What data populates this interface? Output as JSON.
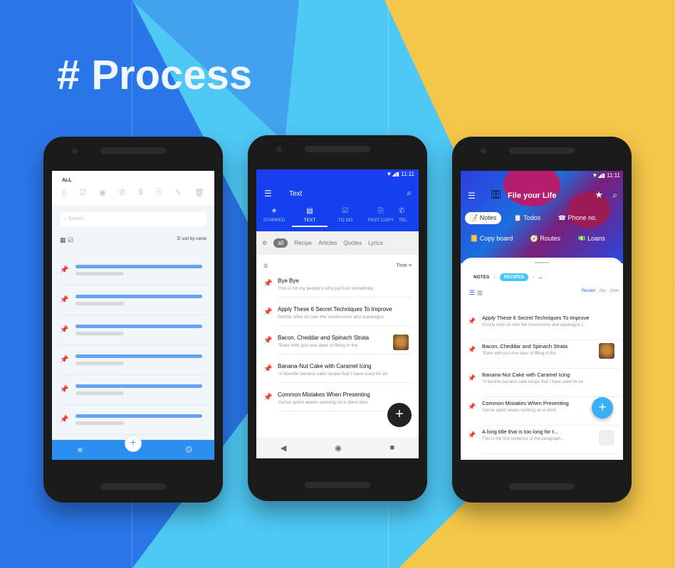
{
  "headline": "# Process",
  "colors": {
    "blue": "#2a76e8",
    "light_blue": "#4ec8f4",
    "yellow": "#f4c64a",
    "primary": "#1440f0"
  },
  "phone1": {
    "header": "ALL",
    "search_placeholder": "Search",
    "sort_label": "sort by name"
  },
  "phone2": {
    "time": "11:11",
    "title": "Text",
    "tabs": [
      "STARRED",
      "TEXT",
      "TO DO",
      "FAST COPY",
      "TEL"
    ],
    "chips": [
      "all",
      "Recipe",
      "Articles",
      "Quotes",
      "Lyrics"
    ],
    "sort_label": "Time",
    "notes": [
      {
        "title": "Bye Bye",
        "snippet": "This is for my people's who just lost somebody"
      },
      {
        "title": "Apply These 6 Secret Techniques To Improve",
        "snippet": "Drizzle olive oil over the mushrooms and asparagus"
      },
      {
        "title": "Bacon, Cheddar and Spinach Strata",
        "snippet": "\"Even with just one layer of filling in the"
      },
      {
        "title": "Banana-Nut Cake with Caramel Icing",
        "snippet": "\"A favorite banana cake recipe that I have used for ev"
      },
      {
        "title": "Common Mistakes When Presenting",
        "snippet": "You've spent weeks working on a client desi"
      }
    ]
  },
  "phone3": {
    "time": "11:11",
    "title": "File your Life",
    "categories": [
      "Notes",
      "Todos",
      "Phone no.",
      "Copy board",
      "Routes",
      "Loans"
    ],
    "breadcrumb": [
      "NOTES",
      "RECIPES",
      "..."
    ],
    "sort_options": [
      "Recent",
      "Abc",
      "Own"
    ],
    "notes": [
      {
        "title": "Apply These 6 Secret Techniques To Improve",
        "snippet": "Drizzle olive oil over the mushrooms and asparagus c"
      },
      {
        "title": "Bacon, Cheddar and Spinach Strata",
        "snippet": "\"Even with just one layer of filling in the"
      },
      {
        "title": "Banana-Nut Cake with Caramel Icing",
        "snippet": "\"A favorite banana cake recipe that I have used for ev"
      },
      {
        "title": "Common Mistakes When Presenting",
        "snippet": "You've spent weeks working on a client"
      },
      {
        "title": "A long title that is too long for t...",
        "snippet": "This is the first sentence of the paragraph..."
      }
    ]
  }
}
